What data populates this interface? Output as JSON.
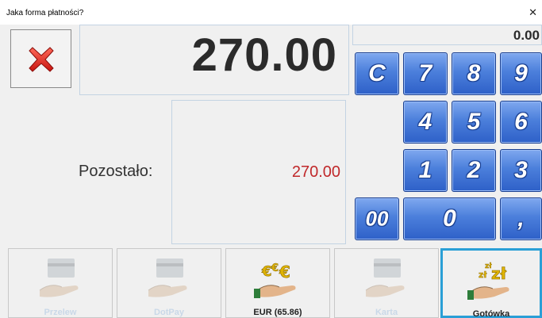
{
  "window": {
    "title": "Jaka forma płatności?",
    "close_glyph": "✕"
  },
  "amount": {
    "main": "270.00",
    "paid_display": "0.00"
  },
  "remaining": {
    "label": "Pozostało:",
    "value": "270.00"
  },
  "keypad": {
    "keys": [
      "C",
      "7",
      "8",
      "9",
      "4",
      "5",
      "6",
      "1",
      "2",
      "3",
      "00",
      "0",
      ","
    ]
  },
  "payments": [
    {
      "label": "Przelew",
      "state": "disabled",
      "icon": "card-hand-icon"
    },
    {
      "label": "DotPay",
      "state": "disabled",
      "icon": "card-hand-icon"
    },
    {
      "label": "EUR (65.86)",
      "state": "enabled",
      "icon": "euro-hand-icon"
    },
    {
      "label": "Karta",
      "state": "disabled",
      "icon": "card-hand-icon"
    },
    {
      "label": "Gotówka",
      "state": "selected",
      "icon": "zloty-hand-icon"
    }
  ],
  "colors": {
    "keypad": "#3a6fd6",
    "remaining_value": "#c0282a",
    "selected_border": "#2a9fd6",
    "cancel": "#e0282a"
  }
}
